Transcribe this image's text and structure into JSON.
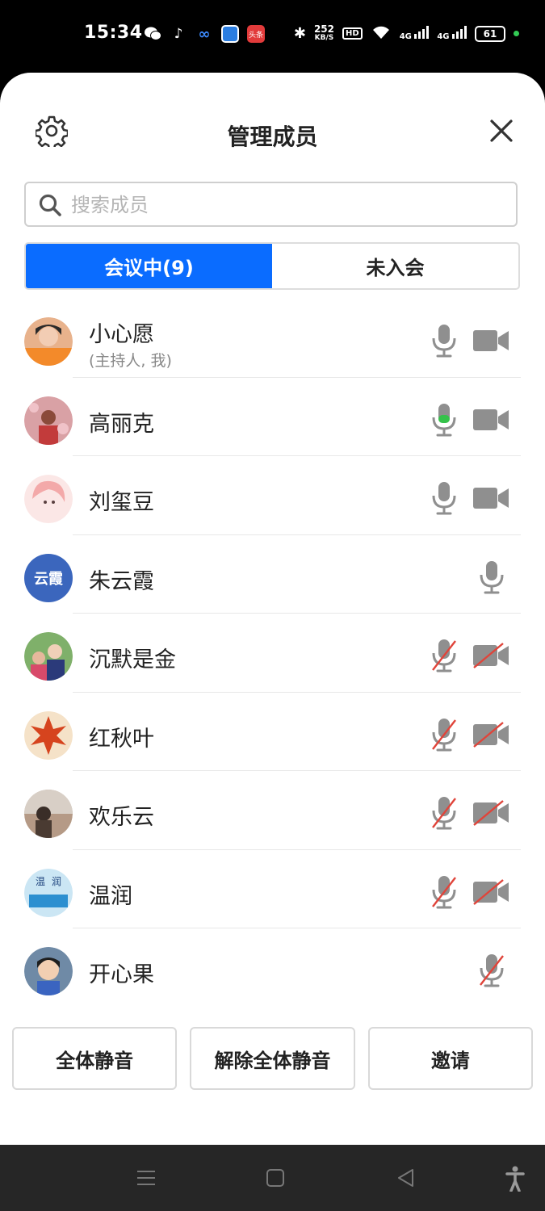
{
  "status_bar": {
    "time": "15:34",
    "net_speed": "252",
    "net_unit": "KB/S",
    "hd": "HD",
    "signal1": "4G",
    "signal2": "4G",
    "battery": "61",
    "apps": [
      {
        "icon": "wechat-icon",
        "label": "微",
        "color": "#000000"
      },
      {
        "icon": "tiktok-icon",
        "label": "♪",
        "color": "#000000"
      },
      {
        "icon": "app-blue-icon",
        "label": "∞",
        "color": "#000000"
      },
      {
        "icon": "app-square-icon",
        "label": "",
        "color": "#2a7de1"
      },
      {
        "icon": "toutiao-icon",
        "label": "头条",
        "color": "#e23b3b"
      }
    ]
  },
  "header": {
    "title": "管理成员"
  },
  "search": {
    "placeholder": "搜索成员"
  },
  "tabs": [
    {
      "label": "会议中(9)",
      "active": true
    },
    {
      "label": "未入会",
      "active": false
    }
  ],
  "members": [
    {
      "name": "小心愿",
      "sub": "(主持人, 我)",
      "avatar": "photo",
      "mic": "on",
      "camera": "on",
      "speaking": false
    },
    {
      "name": "高丽克",
      "sub": "",
      "avatar": "photo",
      "mic": "on",
      "camera": "on",
      "speaking": true
    },
    {
      "name": "刘玺豆",
      "sub": "",
      "avatar": "photo",
      "mic": "on",
      "camera": "on",
      "speaking": false
    },
    {
      "name": "朱云霞",
      "sub": "",
      "avatar_text": "云霞",
      "avatar": "text",
      "mic": "on",
      "camera": "none",
      "speaking": false
    },
    {
      "name": "沉默是金",
      "sub": "",
      "avatar": "photo",
      "mic": "off",
      "camera": "off",
      "speaking": false
    },
    {
      "name": "红秋叶",
      "sub": "",
      "avatar": "photo",
      "mic": "off",
      "camera": "off",
      "speaking": false
    },
    {
      "name": "欢乐云",
      "sub": "",
      "avatar": "photo",
      "mic": "off",
      "camera": "off",
      "speaking": false
    },
    {
      "name": "温润",
      "sub": "",
      "avatar": "photo",
      "mic": "off",
      "camera": "off",
      "speaking": false
    },
    {
      "name": "开心果",
      "sub": "",
      "avatar": "photo",
      "mic": "off",
      "camera": "none",
      "speaking": false
    }
  ],
  "actions": {
    "mute_all": "全体静音",
    "unmute_all": "解除全体静音",
    "invite": "邀请"
  },
  "colors": {
    "accent": "#0a6cff",
    "muted_red": "#e0443a",
    "speaking_green": "#35c24a",
    "icon_gray": "#8f8f8f"
  }
}
